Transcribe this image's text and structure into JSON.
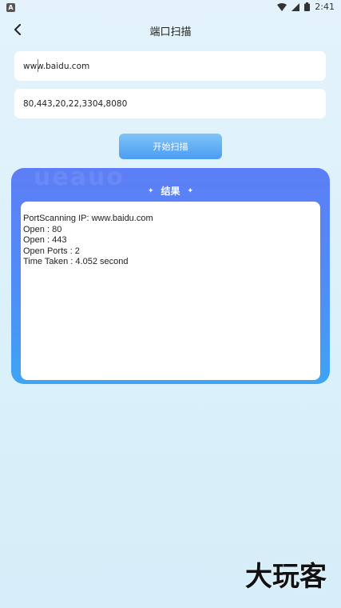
{
  "status_bar": {
    "left_badge": "A",
    "time": "2:41",
    "icons": [
      "wifi-icon",
      "signal-icon",
      "battery-icon"
    ]
  },
  "header": {
    "title": "端口扫描",
    "back_icon": "chevron-left-icon"
  },
  "form": {
    "host_value": "www.baidu.com",
    "ports_value": "80,443,20,22,3304,8080",
    "start_label": "开始扫描"
  },
  "result": {
    "title": "结果",
    "ghost_text": "ueauo",
    "lines": [
      "PortScanning IP: www.baidu.com",
      "Open : 80",
      "Open : 443",
      "Open Ports : 2",
      "Time Taken : 4.052 second"
    ]
  },
  "watermark": "大玩客",
  "colors": {
    "background": "#dff2fb",
    "panel_top": "#5d7ef6",
    "panel_bottom": "#3fa4f4",
    "button_top": "#7fc4f7",
    "button_bottom": "#4b9df3"
  }
}
